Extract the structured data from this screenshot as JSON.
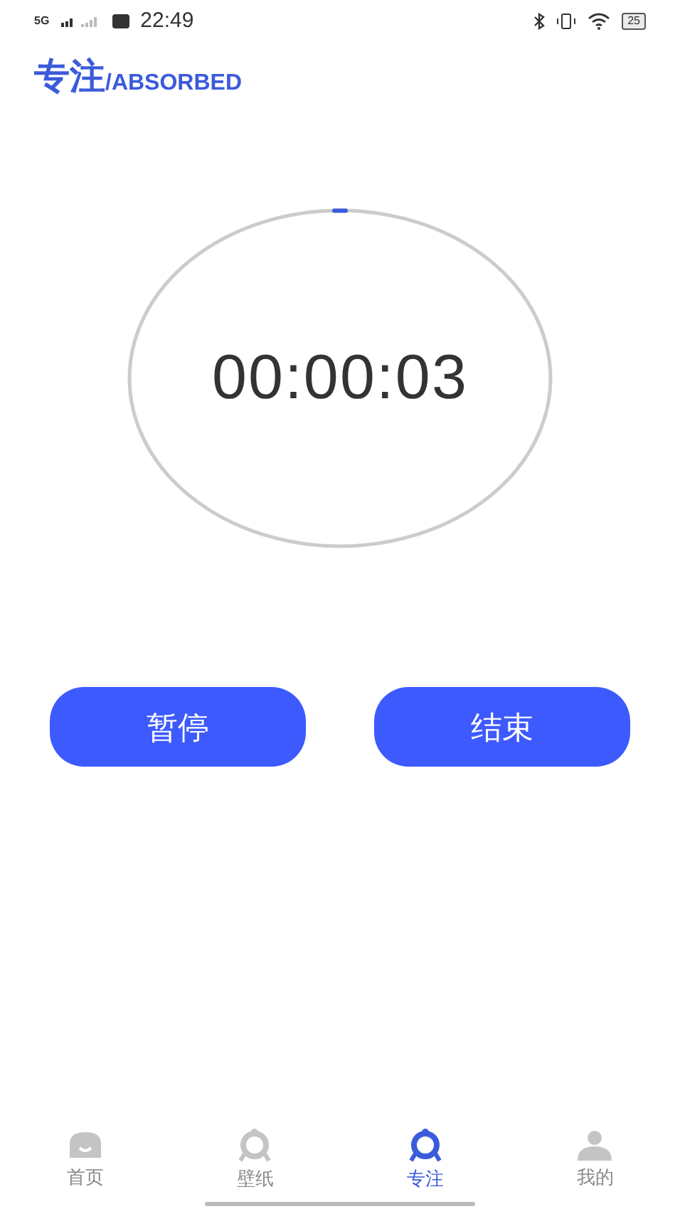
{
  "status_bar": {
    "network": "5G",
    "time": "22:49",
    "battery": "25"
  },
  "header": {
    "title": "专注",
    "subtitle": "/ABSORBED"
  },
  "timer": {
    "time": "00:00:03"
  },
  "buttons": [
    "暂停",
    "结束"
  ],
  "tabs": [
    {
      "label": "首页",
      "selected": false
    },
    {
      "label": "壁纸",
      "selected": false
    },
    {
      "label": "专注",
      "selected": true
    },
    {
      "label": "我的",
      "selected": false
    }
  ]
}
